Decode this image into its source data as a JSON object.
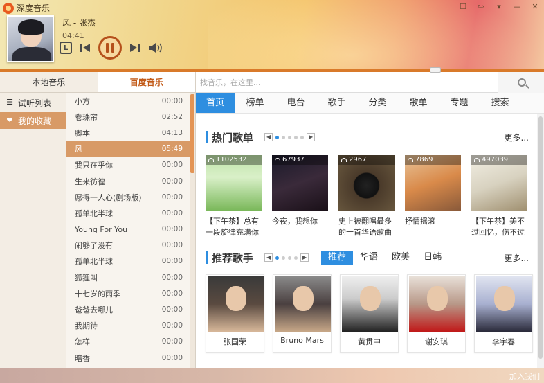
{
  "app": {
    "title": "深度音乐"
  },
  "now_playing": {
    "title": "风 - 张杰",
    "time": "04:41"
  },
  "left_tabs": [
    {
      "label": "本地音乐"
    },
    {
      "label": "百度音乐"
    }
  ],
  "side_nav": [
    {
      "label": "试听列表",
      "icon": "list-icon"
    },
    {
      "label": "我的收藏",
      "icon": "heart-icon"
    }
  ],
  "songs": [
    {
      "title": "小方",
      "duration": "00:00"
    },
    {
      "title": "卷珠帘",
      "duration": "02:52"
    },
    {
      "title": "脚本",
      "duration": "04:13"
    },
    {
      "title": "风",
      "duration": "05:49"
    },
    {
      "title": "我只在乎你",
      "duration": "00:00"
    },
    {
      "title": "生来彷徨",
      "duration": "00:00"
    },
    {
      "title": "愿得一人心(剧场版)",
      "duration": "00:00"
    },
    {
      "title": "孤单北半球",
      "duration": "00:00"
    },
    {
      "title": "Young For You",
      "duration": "00:00"
    },
    {
      "title": "闹够了没有",
      "duration": "00:00"
    },
    {
      "title": "孤单北半球",
      "duration": "00:00"
    },
    {
      "title": "狐狸叫",
      "duration": "00:00"
    },
    {
      "title": "十七岁的雨季",
      "duration": "00:00"
    },
    {
      "title": "爸爸去哪儿",
      "duration": "00:00"
    },
    {
      "title": "我期待",
      "duration": "00:00"
    },
    {
      "title": "怎样",
      "duration": "00:00"
    },
    {
      "title": "暗香",
      "duration": "00:00"
    }
  ],
  "search": {
    "placeholder": "找音乐，在这里..."
  },
  "nav_tabs": [
    {
      "label": "首页"
    },
    {
      "label": "榜单"
    },
    {
      "label": "电台"
    },
    {
      "label": "歌手"
    },
    {
      "label": "分类"
    },
    {
      "label": "歌单"
    },
    {
      "label": "专题"
    },
    {
      "label": "搜索"
    }
  ],
  "hot_playlists": {
    "title": "热门歌单",
    "more": "更多...",
    "items": [
      {
        "count": "1102532",
        "desc": "【下午茶】总有一段旋律充满你"
      },
      {
        "count": "67937",
        "desc": "今夜，我想你"
      },
      {
        "count": "2967",
        "desc": "史上被翻唱最多的十首华语歌曲"
      },
      {
        "count": "7869",
        "desc": "抒情摇滚"
      },
      {
        "count": "497039",
        "desc": "【下午茶】美不过回忆，伤不过"
      }
    ]
  },
  "recommended_artists": {
    "title": "推荐歌手",
    "more": "更多...",
    "filters": [
      {
        "label": "推荐"
      },
      {
        "label": "华语"
      },
      {
        "label": "欧美"
      },
      {
        "label": "日韩"
      }
    ],
    "items": [
      {
        "name": "张国荣"
      },
      {
        "name": "Bruno Mars"
      },
      {
        "name": "黄贯中"
      },
      {
        "name": "谢安琪"
      },
      {
        "name": "李宇春"
      }
    ]
  },
  "footer": {
    "link": "加入我们"
  },
  "playback": {
    "progress": 0.8
  }
}
